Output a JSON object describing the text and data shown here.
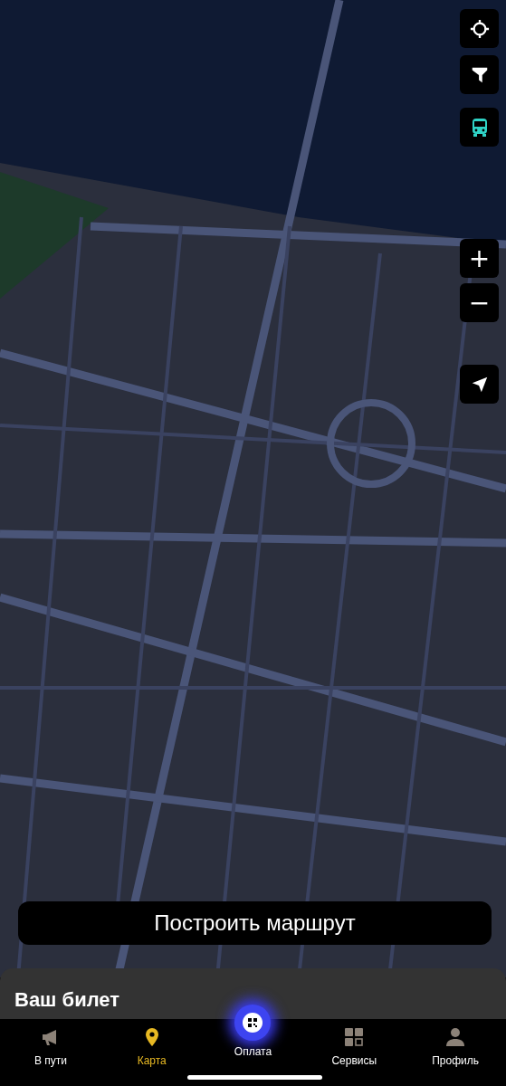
{
  "map_controls": [
    {
      "kind": "icon"
    },
    {
      "kind": "icon"
    },
    {
      "kind": "icon"
    }
  ],
  "zoom": {
    "plus": "+",
    "minus": "−"
  },
  "route_button": "Построить маршрут",
  "sheet": {
    "title": "Ваш билет"
  },
  "bottom_nav": [
    {
      "label": "В пути",
      "kind": "tab",
      "selected": false
    },
    {
      "label": "Карта",
      "kind": "tab",
      "selected": true
    },
    {
      "label": "Оплата",
      "kind": "center",
      "selected": false
    },
    {
      "label": "Сервисы",
      "kind": "tab",
      "selected": false
    },
    {
      "label": "Профиль",
      "kind": "tab",
      "selected": false
    }
  ]
}
